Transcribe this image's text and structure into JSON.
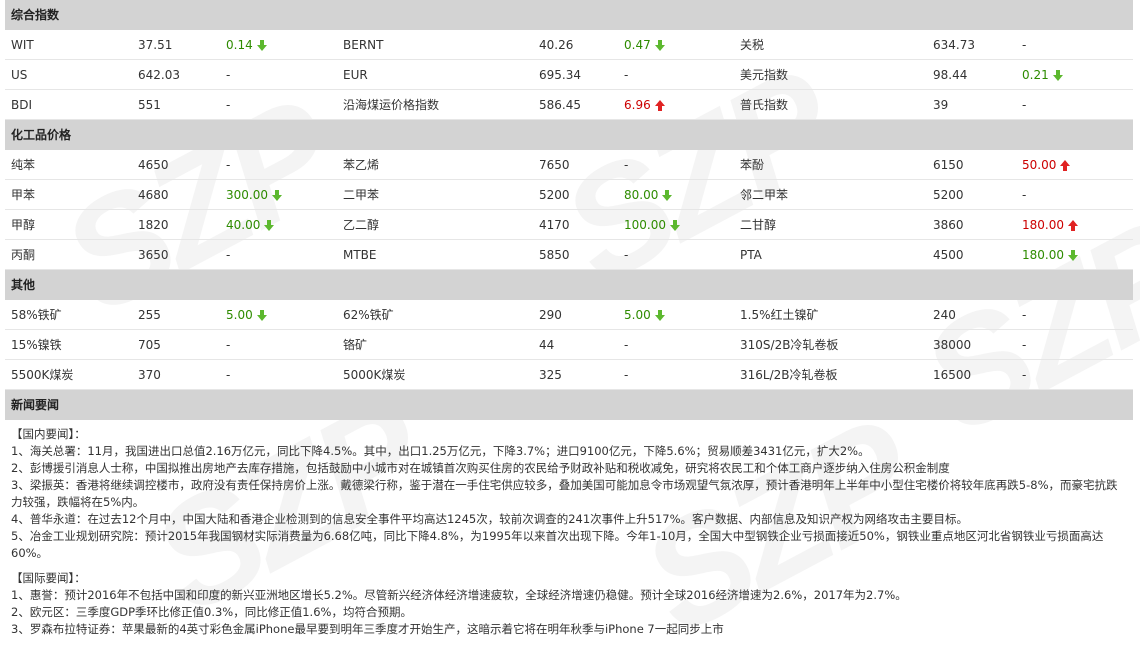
{
  "sections": [
    {
      "title": "综合指数",
      "rows": [
        [
          {
            "name": "WIT",
            "price": "37.51",
            "change": "0.14",
            "dir": "down"
          },
          {
            "name": "BERNT",
            "price": "40.26",
            "change": "0.47",
            "dir": "down"
          },
          {
            "name": "关税",
            "price": "634.73",
            "change": "-",
            "dir": "none"
          }
        ],
        [
          {
            "name": "US",
            "price": "642.03",
            "change": "-",
            "dir": "none"
          },
          {
            "name": "EUR",
            "price": "695.34",
            "change": "-",
            "dir": "none"
          },
          {
            "name": "美元指数",
            "price": "98.44",
            "change": "0.21",
            "dir": "down"
          }
        ],
        [
          {
            "name": "BDI",
            "price": "551",
            "change": "-",
            "dir": "none"
          },
          {
            "name": "沿海煤运价格指数",
            "price": "586.45",
            "change": "6.96",
            "dir": "up"
          },
          {
            "name": "普氏指数",
            "price": "39",
            "change": "-",
            "dir": "none"
          }
        ]
      ]
    },
    {
      "title": "化工品价格",
      "rows": [
        [
          {
            "name": "纯苯",
            "price": "4650",
            "change": "-",
            "dir": "none"
          },
          {
            "name": "苯乙烯",
            "price": "7650",
            "change": "-",
            "dir": "none"
          },
          {
            "name": "苯酚",
            "price": "6150",
            "change": "50.00",
            "dir": "up"
          }
        ],
        [
          {
            "name": "甲苯",
            "price": "4680",
            "change": "300.00",
            "dir": "down"
          },
          {
            "name": "二甲苯",
            "price": "5200",
            "change": "80.00",
            "dir": "down"
          },
          {
            "name": "邻二甲苯",
            "price": "5200",
            "change": "-",
            "dir": "none"
          }
        ],
        [
          {
            "name": "甲醇",
            "price": "1820",
            "change": "40.00",
            "dir": "down"
          },
          {
            "name": "乙二醇",
            "price": "4170",
            "change": "100.00",
            "dir": "down"
          },
          {
            "name": "二甘醇",
            "price": "3860",
            "change": "180.00",
            "dir": "up"
          }
        ],
        [
          {
            "name": "丙酮",
            "price": "3650",
            "change": "-",
            "dir": "none"
          },
          {
            "name": "MTBE",
            "price": "5850",
            "change": "-",
            "dir": "none"
          },
          {
            "name": "PTA",
            "price": "4500",
            "change": "180.00",
            "dir": "down"
          }
        ]
      ]
    },
    {
      "title": "其他",
      "rows": [
        [
          {
            "name": "58%铁矿",
            "price": "255",
            "change": "5.00",
            "dir": "down"
          },
          {
            "name": "62%铁矿",
            "price": "290",
            "change": "5.00",
            "dir": "down"
          },
          {
            "name": "1.5%红土镍矿",
            "price": "240",
            "change": "-",
            "dir": "none"
          }
        ],
        [
          {
            "name": "15%镍铁",
            "price": "705",
            "change": "-",
            "dir": "none"
          },
          {
            "name": "铬矿",
            "price": "44",
            "change": "-",
            "dir": "none"
          },
          {
            "name": "310S/2B冷轧卷板",
            "price": "38000",
            "change": "-",
            "dir": "none"
          }
        ],
        [
          {
            "name": "5500K煤炭",
            "price": "370",
            "change": "-",
            "dir": "none"
          },
          {
            "name": "5000K煤炭",
            "price": "325",
            "change": "-",
            "dir": "none"
          },
          {
            "name": "316L/2B冷轧卷板",
            "price": "16500",
            "change": "-",
            "dir": "none"
          }
        ]
      ]
    }
  ],
  "news": {
    "title": "新闻要闻",
    "groups": [
      {
        "label": "【国内要闻】：",
        "items": [
          "1、海关总署：11月，我国进出口总值2.16万亿元，同比下降4.5%。其中，出口1.25万亿元，下降3.7%；进口9100亿元，下降5.6%；贸易顺差3431亿元，扩大2%。",
          "2、彭博援引消息人士称，中国拟推出房地产去库存措施，包括鼓励中小城市对在城镇首次购买住房的农民给予财政补贴和税收减免，研究将农民工和个体工商户逐步纳入住房公积金制度",
          "3、梁振英：香港将继续调控楼市，政府没有责任保持房价上涨。戴德梁行称，鉴于潜在一手住宅供应较多，叠加美国可能加息令市场观望气氛浓厚，预计香港明年上半年中小型住宅楼价将较年底再跌5-8%，而豪宅抗跌力较强，跌幅将在5%内。",
          "4、普华永道：在过去12个月中，中国大陆和香港企业检测到的信息安全事件平均高达1245次，较前次调查的241次事件上升517%。客户数据、内部信息及知识产权为网络攻击主要目标。",
          "5、冶金工业规划研究院：预计2015年我国钢材实际消费量为6.68亿吨，同比下降4.8%，为1995年以来首次出现下降。今年1-10月，全国大中型钢铁企业亏损面接近50%，钢铁业重点地区河北省钢铁业亏损面高达60%。"
        ]
      },
      {
        "label": "【国际要闻】：",
        "items": [
          "1、惠誉：预计2016年不包括中国和印度的新兴亚洲地区增长5.2%。尽管新兴经济体经济增速疲软，全球经济增速仍稳健。预计全球2016经济增速为2.6%，2017年为2.7%。",
          "2、欧元区：三季度GDP季环比修正值0.3%，同比修正值1.6%，均符合预期。",
          "3、罗森布拉特证券：苹果最新的4英寸彩色金属iPhone最早要到明年三季度才开始生产，这暗示着它将在明年秋季与iPhone 7一起同步上市"
        ]
      }
    ]
  },
  "colors": {
    "down": "#5cb82e",
    "up": "#e02222",
    "header_bg": "#d3d3d3"
  },
  "icons": {
    "down": "arrow-down-icon",
    "up": "arrow-up-icon"
  }
}
